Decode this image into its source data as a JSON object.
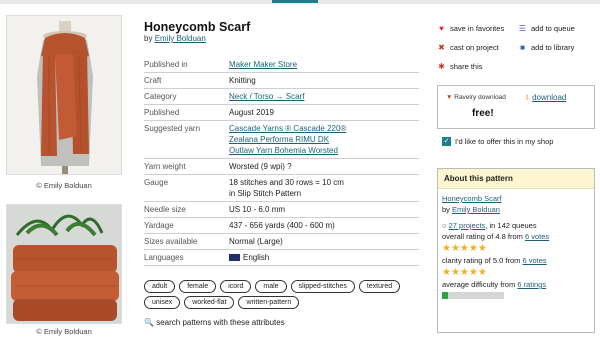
{
  "pattern": {
    "title": "Honeycomb Scarf",
    "by": "by",
    "designer": "Emily Bolduan"
  },
  "photos": {
    "credit1": "© Emily Bolduan",
    "credit2": "© Emily Bolduan"
  },
  "details": [
    {
      "label": "Published in",
      "values": [
        "Maker Maker Store"
      ],
      "link": true
    },
    {
      "label": "Craft",
      "values": [
        "Knitting"
      ],
      "link": false
    },
    {
      "label": "Category",
      "values": [
        "Neck / Torso → Scarf"
      ],
      "link": true
    },
    {
      "label": "Published",
      "values": [
        "August 2019"
      ],
      "link": false
    },
    {
      "label": "Suggested yarn",
      "values": [
        "Cascade Yarns ® Cascade 220®",
        "Zealana Performa RIMU DK",
        "Outlaw Yarn Bohemia Worsted"
      ],
      "link": true
    },
    {
      "label": "Yarn weight",
      "values": [
        "Worsted (9 wpi) ?"
      ],
      "link": false
    },
    {
      "label": "Gauge",
      "values": [
        "18 stitches and 30 rows = 10 cm",
        "in Slip Stitch Pattern"
      ],
      "link": false
    },
    {
      "label": "Needle size",
      "values": [
        "US 10 - 6.0 mm"
      ],
      "link": false
    },
    {
      "label": "Yardage",
      "values": [
        "437 - 656 yards (400 - 600 m)"
      ],
      "link": false
    },
    {
      "label": "Sizes available",
      "values": [
        "Normal (Large)"
      ],
      "link": false
    },
    {
      "label": "Languages",
      "values": [
        "English"
      ],
      "link": false,
      "flag": true
    }
  ],
  "tags": [
    "adult",
    "female",
    "icord",
    "male",
    "slipped-stitches",
    "textured",
    "unisex",
    "worked-flat",
    "written-pattern"
  ],
  "search_attrs": "search patterns with these attributes",
  "actions": {
    "favorites": "save in favorites",
    "queue": "add to queue",
    "cast_on": "cast on project",
    "library": "add to library",
    "share": "share this"
  },
  "download": {
    "ravelry": "Ravelry download",
    "link": "download",
    "price": "free!"
  },
  "offer": "I'd like to offer this in my shop",
  "about": {
    "header": "About this pattern",
    "name": "Honeycomb Scarf",
    "by": "by",
    "designer": "Emily Bolduan",
    "projects": "27 projects",
    "queues": ", in 142 queues",
    "overall": "overall rating of 4.8 from",
    "overall_votes": "6 votes",
    "clarity": "clarity rating of 5.0 from",
    "clarity_votes": "6 votes",
    "difficulty": "average difficulty from",
    "difficulty_ratings": "6 ratings",
    "overall_stars": 4.8,
    "clarity_stars": 5.0,
    "difficulty_level": 0.1
  },
  "colors": {
    "accent": "#1c7f8c",
    "link": "#1f5f7a",
    "star": "#f0b21b",
    "scarf": "#b8532f"
  }
}
